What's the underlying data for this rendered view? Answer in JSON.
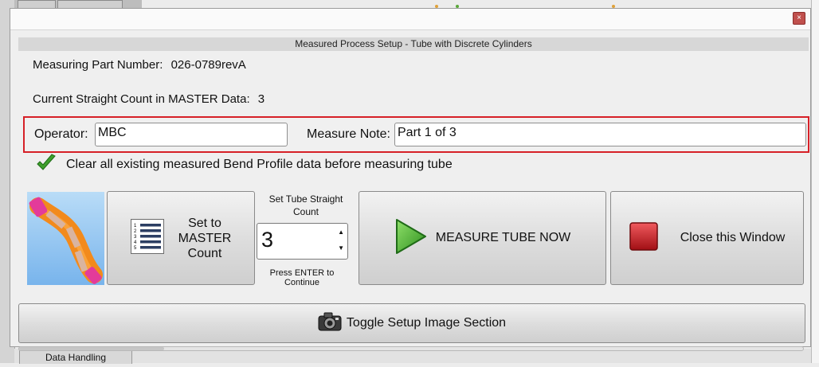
{
  "background": {
    "tab_label": "Data Handling"
  },
  "dialog": {
    "close_label": "×",
    "header": "Measured Process Setup - Tube with Discrete Cylinders",
    "part_number_label": "Measuring Part Number:",
    "part_number_value": "026-0789revA",
    "straight_count_label": "Current Straight Count in MASTER Data:",
    "straight_count_value": "3",
    "operator_label": "Operator:",
    "operator_value": "MBC",
    "note_label": "Measure Note:",
    "note_value": "Part 1 of 3",
    "clear_checkbox_label": "Clear all existing measured Bend Profile data before measuring tube",
    "clear_checked": true,
    "set_master_line1": "Set to",
    "set_master_line2": "MASTER",
    "set_master_line3": "Count",
    "list_numbers": [
      "1",
      "2",
      "3",
      "4",
      "5"
    ],
    "set_straight_label": "Set Tube Straight Count",
    "straight_value": "3",
    "press_enter": "Press ENTER to Continue",
    "measure_label": "MEASURE TUBE NOW",
    "close_window_label": "Close this Window",
    "toggle_label": "Toggle Setup Image Section"
  },
  "colors": {
    "highlight_border": "#d62027",
    "play_green": "#3fa02c",
    "stop_red": "#c8181e",
    "tube_orange": "#f28a1c",
    "tube_pink": "#e33b9a"
  }
}
